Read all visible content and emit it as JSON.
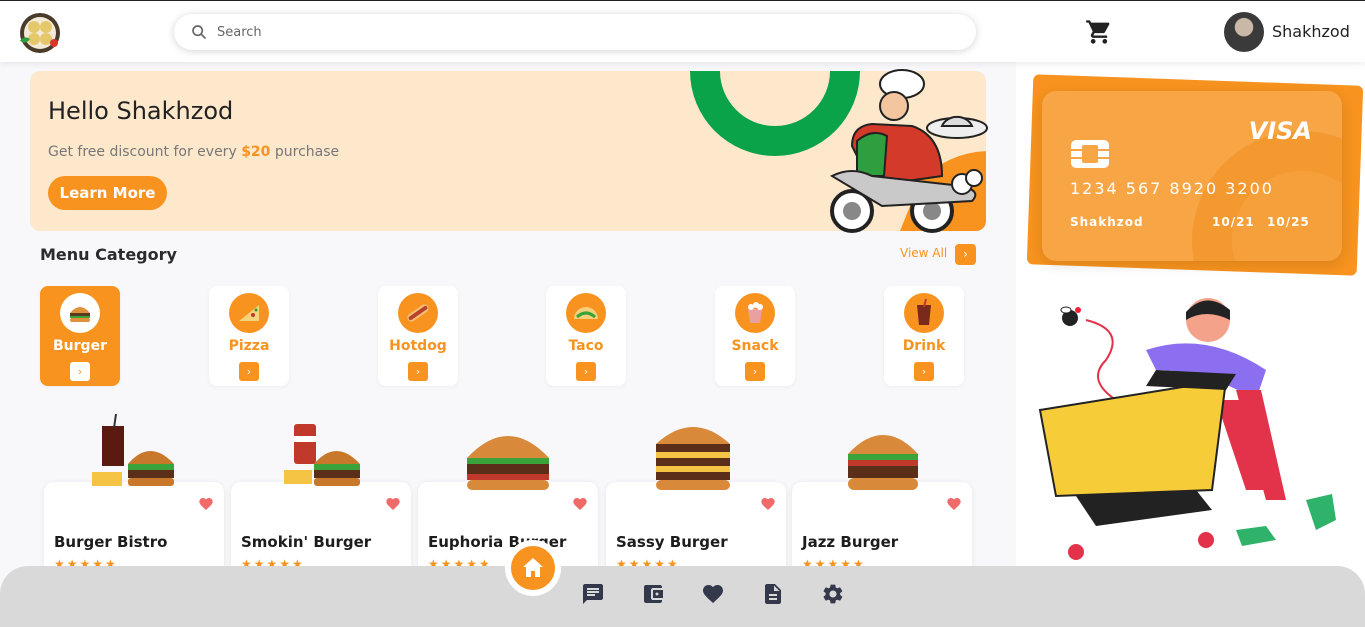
{
  "header": {
    "search_placeholder": "Search",
    "username": "Shakhzod"
  },
  "hero": {
    "title": "Hello Shakhzod",
    "subtitle_prefix": "Get free discount for every",
    "subtitle_amount": "$20",
    "subtitle_suffix": "purchase",
    "button_label": "Learn More"
  },
  "menu": {
    "title": "Menu Category",
    "view_all": "View All",
    "categories": [
      {
        "label": "Burger",
        "active": true
      },
      {
        "label": "Pizza",
        "active": false
      },
      {
        "label": "Hotdog",
        "active": false
      },
      {
        "label": "Taco",
        "active": false
      },
      {
        "label": "Snack",
        "active": false
      },
      {
        "label": "Drink",
        "active": false
      }
    ]
  },
  "products": [
    {
      "name": "Burger Bistro",
      "rating": 5
    },
    {
      "name": "Smokin' Burger",
      "rating": 5
    },
    {
      "name": "Euphoria Burger",
      "rating": 5
    },
    {
      "name": "Sassy Burger",
      "rating": 5
    },
    {
      "name": "Jazz Burger",
      "rating": 5
    }
  ],
  "card": {
    "brand": "VISA",
    "number": "1234 567 8920 3200",
    "holder": "Shakhzod",
    "date_from": "10/21",
    "date_to": "10/25"
  },
  "colors": {
    "accent": "#f7931e",
    "hero_bg": "#fee8cc",
    "nav_bg": "#d9d9d9"
  },
  "icons": {
    "bottom_nav": [
      "home-icon",
      "chat-icon",
      "wallet-icon",
      "heart-icon",
      "document-icon",
      "settings-icon"
    ]
  }
}
